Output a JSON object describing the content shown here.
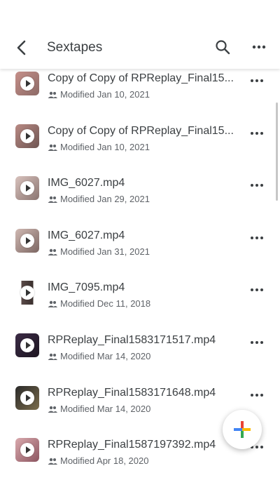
{
  "header": {
    "title": "Sextapes",
    "back_icon": "chevron-left-icon",
    "search_icon": "search-icon",
    "more_icon": "more-horizontal-icon"
  },
  "files": [
    {
      "name": "Copy of Copy of RPReplay_Final15...",
      "modified": "Modified Jan 10, 2021"
    },
    {
      "name": "Copy of Copy of RPReplay_Final15...",
      "modified": "Modified Jan 10, 2021"
    },
    {
      "name": "IMG_6027.mp4",
      "modified": "Modified Jan 29, 2021"
    },
    {
      "name": "IMG_6027.mp4",
      "modified": "Modified Jan 31, 2021"
    },
    {
      "name": "IMG_7095.mp4",
      "modified": "Modified Dec 11, 2018"
    },
    {
      "name": "RPReplay_Final1583171517.mp4",
      "modified": "Modified Mar 14, 2020"
    },
    {
      "name": "RPReplay_Final1583171648.mp4",
      "modified": "Modified Mar 14, 2020"
    },
    {
      "name": "RPReplay_Final1587197392.mp4",
      "modified": "Modified Apr 18, 2020"
    }
  ],
  "fab": {
    "icon": "plus-icon",
    "colors": [
      "#4285f4",
      "#ea4335",
      "#fbbc04",
      "#34a853"
    ]
  }
}
